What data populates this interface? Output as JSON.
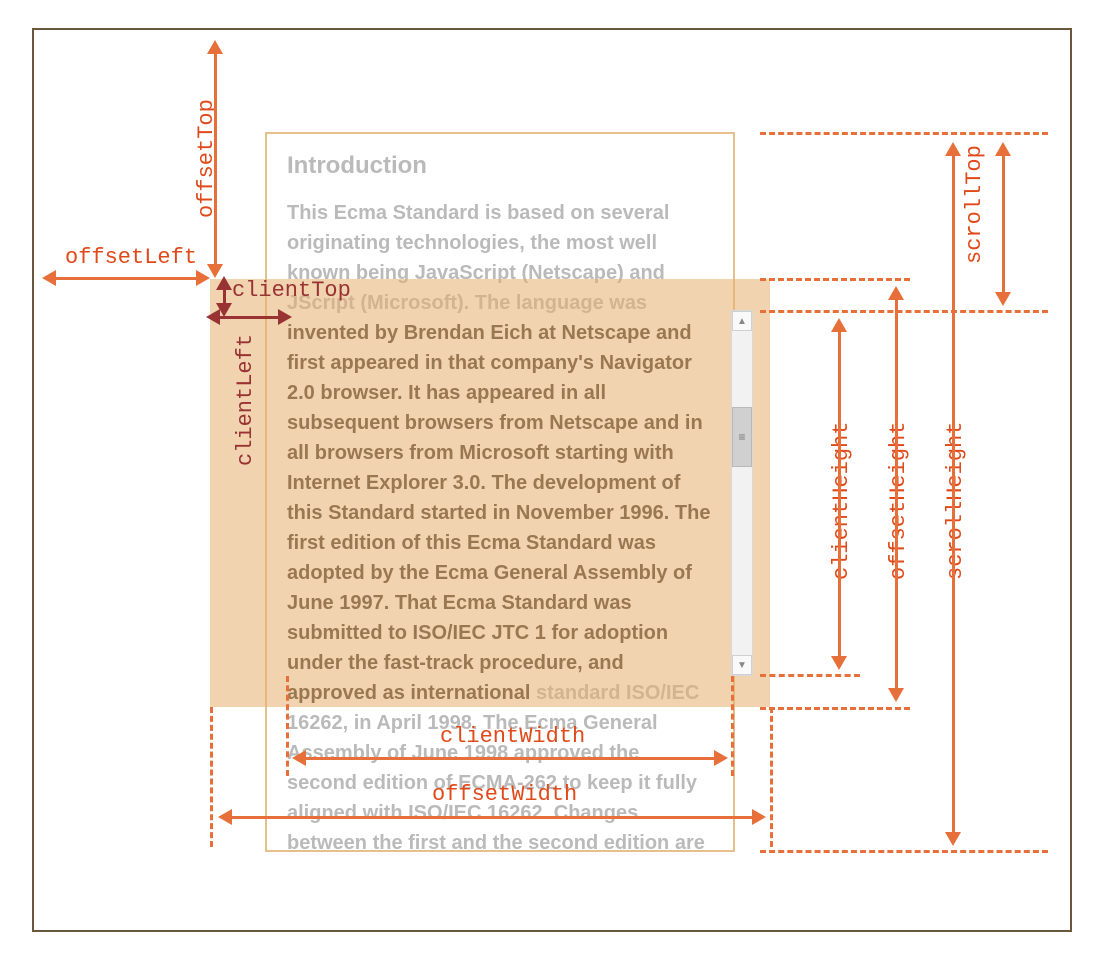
{
  "labels": {
    "offsetTop": "offsetTop",
    "offsetLeft": "offsetLeft",
    "clientTop": "clientTop",
    "clientLeft": "clientLeft",
    "clientWidth": "clientWidth",
    "offsetWidth": "offsetWidth",
    "clientHeight": "clientHeight",
    "offsetHeight": "offsetHeight",
    "scrollHeight": "scrollHeight",
    "scrollTop": "scrollTop"
  },
  "content": {
    "heading": "Introduction",
    "para_pre": "This Ecma Standard is based on several originating technologies, the most well known being JavaScript (Netscape) and JScript (Microsoft). The language was ",
    "para_bold": "invented by Brendan Eich at Netscape and first appeared in that company's Navigator 2.0 browser. It has appeared in all subsequent browsers from Netscape and in all browsers from Microsoft starting with Internet Explorer 3.0.\nThe development of this Standard started in November 1996. The first edition of this Ecma Standard was adopted by the Ecma General Assembly of June 1997.\nThat Ecma Standard was submitted to ISO/IEC JTC 1 for adoption under the fast-track procedure, and approved as international ",
    "para_post": "standard ISO/IEC 16262, in April 1998. The Ecma General Assembly of June 1998 approved the second edition of ECMA-262 to keep it fully aligned with ISO/IEC 16262. Changes between the first and the second edition are editorial in nature."
  },
  "scrollbar": {
    "up": "▲",
    "down": "▼",
    "grip": "≡"
  }
}
